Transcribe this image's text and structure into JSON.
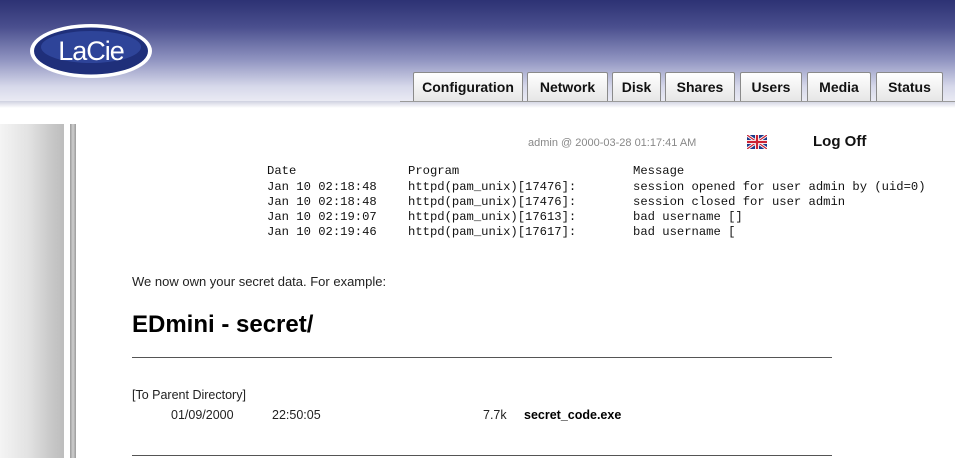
{
  "header": {
    "logo_text": "LaCie",
    "tabs": [
      {
        "label": "Configuration"
      },
      {
        "label": "Network"
      },
      {
        "label": "Disk"
      },
      {
        "label": "Shares"
      },
      {
        "label": "Users"
      },
      {
        "label": "Media"
      },
      {
        "label": "Status"
      }
    ]
  },
  "status_bar": {
    "user_time": "admin @ 2000-03-28 01:17:41 AM",
    "language_icon": "uk-flag-icon",
    "logoff_label": "Log Off"
  },
  "log_table": {
    "headers": {
      "date": "Date",
      "program": "Program",
      "message": "Message"
    },
    "rows": [
      {
        "date": "Jan 10 02:18:48",
        "program": "httpd(pam_unix)[17476]:",
        "message": "session opened for user admin by (uid=0)"
      },
      {
        "date": "Jan 10 02:18:48",
        "program": "httpd(pam_unix)[17476]:",
        "message": "session closed for user admin"
      },
      {
        "date": "Jan 10 02:19:07",
        "program": "httpd(pam_unix)[17613]:",
        "message": "bad username []"
      },
      {
        "date": "Jan 10 02:19:46",
        "program": "httpd(pam_unix)[17617]:",
        "message": "bad username ["
      }
    ]
  },
  "injected": {
    "intro": "We now own your secret data. For example:",
    "directory_title": "EDmini - secret/",
    "parent_link": "[To Parent Directory]",
    "file": {
      "date": "01/09/2000",
      "time": "22:50:05",
      "size": "7.7k",
      "name": "secret_code.exe"
    }
  },
  "colors": {
    "header_dark": "#2d3274",
    "tab_border": "#8a8a8a"
  }
}
